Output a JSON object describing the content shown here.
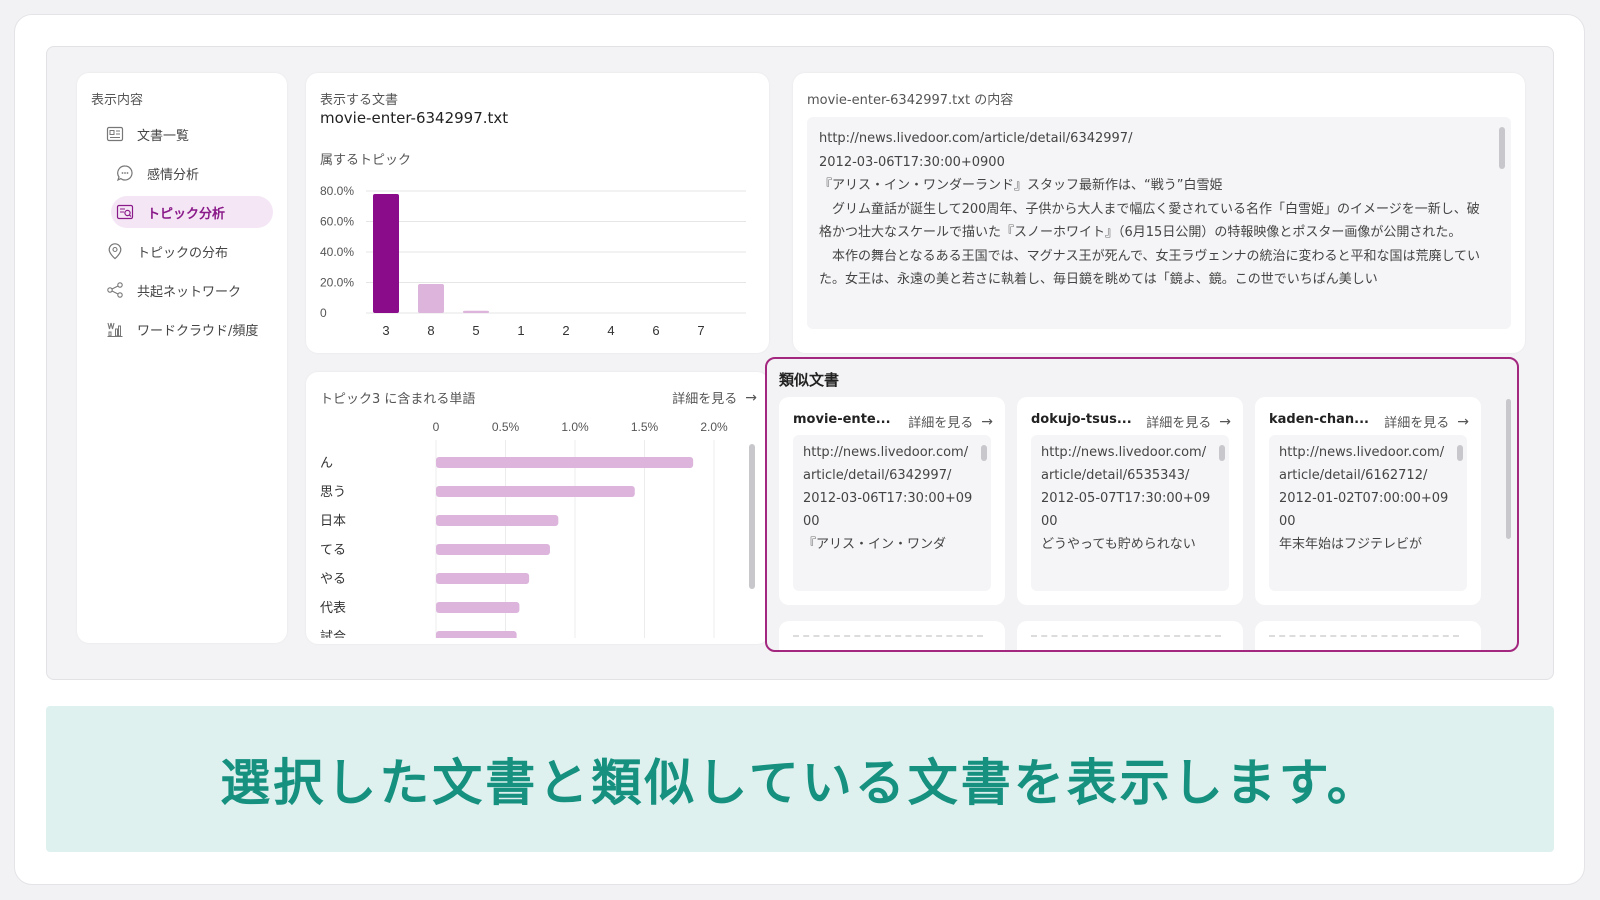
{
  "sidebar": {
    "title": "表示内容",
    "items": [
      {
        "label": "文書一覧",
        "icon": "document-list-icon"
      },
      {
        "label": "感情分析",
        "icon": "chat-bubble-icon"
      },
      {
        "label": "トピック分析",
        "icon": "topic-analysis-icon"
      },
      {
        "label": "トピックの分布",
        "icon": "location-pin-icon"
      },
      {
        "label": "共起ネットワーク",
        "icon": "network-icon"
      },
      {
        "label": "ワードクラウド/頻度",
        "icon": "word-cloud-icon"
      }
    ],
    "active_index": 2
  },
  "doc": {
    "label": "表示する文書",
    "filename": "movie-enter-6342997.txt",
    "topic_label": "属するトピック"
  },
  "content": {
    "title": "movie-enter-6342997.txt の内容",
    "lines": [
      "http://news.livedoor.com/article/detail/6342997/",
      "2012-03-06T17:30:00+0900",
      "『アリス・イン・ワンダーランド』スタッフ最新作は、“戦う”白雪姫",
      "　グリム童話が誕生して200周年、子供から大人まで幅広く愛されている名作「白雪姫」のイメージを一新し、破格かつ壮大なスケールで描いた『スノーホワイト』（6月15日公開）の特報映像とポスター画像が公開された。",
      "",
      "　本作の舞台となるある王国では、マグナス王が死んで、女王ラヴェンナの統治に変わると平和な国は荒廃していた。女王は、永遠の美と若さに執着し、毎日鏡を眺めては「鏡よ、鏡。この世でいちばん美しい"
    ]
  },
  "words": {
    "title": "トピック3 に含まれる単語",
    "detail_label": "詳細を見る"
  },
  "similar": {
    "title": "類似文書",
    "detail_label": "詳細を見る",
    "cards": [
      {
        "name": "movie-ente...",
        "text": "http://news.livedoor.com/article/detail/6342997/\n2012-03-06T17:30:00+0900\n『アリス・イン・ワンダ"
      },
      {
        "name": "dokujo-tsus...",
        "text": "http://news.livedoor.com/article/detail/6535343/\n2012-05-07T17:30:00+0900\nどうやっても貯められない"
      },
      {
        "name": "kaden-chan...",
        "text": "http://news.livedoor.com/article/detail/6162712/\n2012-01-02T07:00:00+0900\n年末年始はフジテレビが"
      }
    ]
  },
  "caption": "選択した文書と類似している文書を表示します。",
  "colors": {
    "accent": "#8a0c8a",
    "bar_light": "#dcb4dc",
    "highlight_border": "#a3267f",
    "caption_text": "#16907f",
    "caption_bg": "#def1ef"
  },
  "chart_data": [
    {
      "type": "bar",
      "title": "",
      "categories": [
        "3",
        "8",
        "5",
        "1",
        "2",
        "4",
        "6",
        "7"
      ],
      "values": [
        78,
        19,
        1.5,
        0,
        0,
        0,
        0,
        0
      ],
      "yticks": [
        "0",
        "20.0%",
        "40.0%",
        "60.0%",
        "80.0%"
      ],
      "ylim": [
        0,
        80
      ],
      "grid": true
    },
    {
      "type": "bar",
      "orientation": "horizontal",
      "categories": [
        "ん",
        "思う",
        "日本",
        "てる",
        "やる",
        "代表",
        "試合"
      ],
      "values": [
        1.85,
        1.43,
        0.88,
        0.82,
        0.67,
        0.6,
        0.58
      ],
      "xticks": [
        "0",
        "0.5%",
        "1.0%",
        "1.5%",
        "2.0%"
      ],
      "xlim": [
        0,
        2.0
      ],
      "grid": true
    }
  ]
}
